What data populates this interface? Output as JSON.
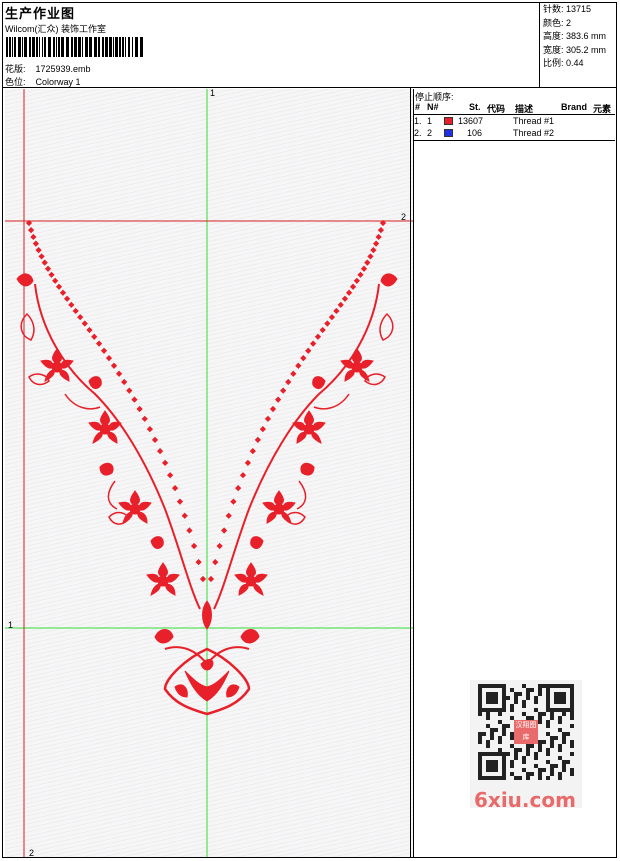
{
  "header": {
    "title": "生产作业图",
    "subtitle": "Wilcom(汇众) 装饰工作室",
    "design_label": "花版:",
    "design_value": "1725939.emb",
    "colorway_label": "色位:",
    "colorway_value": "Colorway 1"
  },
  "stats": {
    "stitches": "针数: 13715",
    "colors": "颜色: 2",
    "height": "高度: 383.6 mm",
    "width": "宽度: 305.2 mm",
    "scale": "比例: 0.44"
  },
  "stop_sequence": {
    "title": "停止顺序:",
    "columns": [
      "#",
      "N#",
      "St.",
      "代码",
      "描述",
      "Brand",
      "元素"
    ],
    "rows": [
      {
        "index": "1.",
        "needle": "1",
        "code": "13607",
        "description": "Thread #1",
        "color": "#e8202a"
      },
      {
        "index": "2.",
        "needle": "2",
        "code": "106",
        "description": "Thread #2",
        "color": "#1f2fe6"
      }
    ]
  },
  "guides": {
    "v_green_top": "1",
    "h_red_right": "2",
    "h_green_left": "1",
    "v_red_bottom": "2"
  },
  "colors": {
    "embroidery": "#e8202a",
    "guide_green": "#33dd33",
    "guide_red": "#d42020"
  },
  "watermark": {
    "qr_stamp": "汉翔图库",
    "site": "6xiu.com"
  }
}
